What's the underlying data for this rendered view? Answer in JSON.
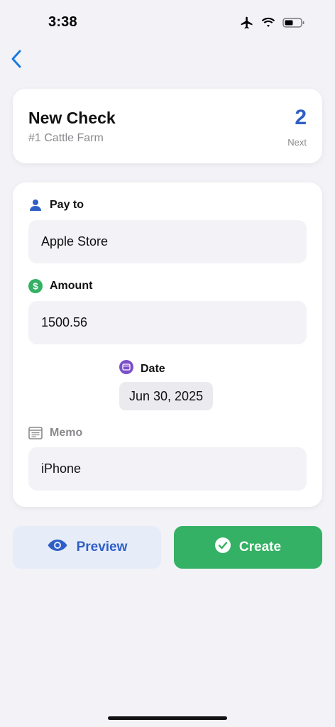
{
  "status_bar": {
    "time": "3:38",
    "icons": [
      "airplane-icon",
      "wifi-icon",
      "battery-icon"
    ]
  },
  "nav": {
    "back_icon": "chevron-left-icon"
  },
  "header": {
    "title": "New Check",
    "subtitle": "#1 Cattle Farm",
    "check_number": "2",
    "next_label": "Next"
  },
  "form": {
    "pay_to": {
      "label": "Pay to",
      "value": "Apple Store",
      "icon": "person-icon"
    },
    "amount": {
      "label": "Amount",
      "value": "1500.56",
      "icon": "dollar-icon"
    },
    "date": {
      "label": "Date",
      "value": "Jun 30, 2025",
      "icon": "calendar-icon"
    },
    "memo": {
      "label": "Memo",
      "value": "iPhone",
      "icon": "memo-icon"
    }
  },
  "actions": {
    "preview_label": "Preview",
    "create_label": "Create"
  },
  "colors": {
    "accent_blue": "#2f5fc6",
    "create_green": "#34b164",
    "preview_bg": "#e6ecf8",
    "background": "#f2f2f7"
  }
}
